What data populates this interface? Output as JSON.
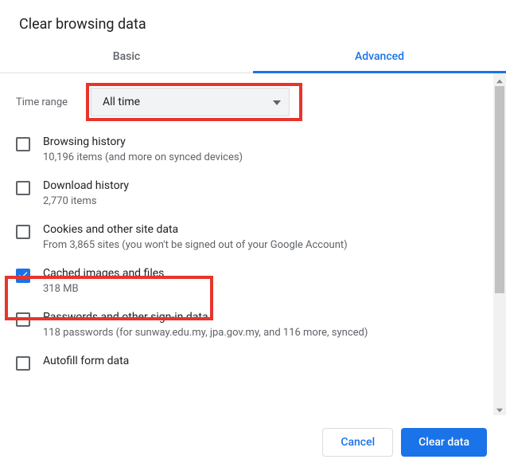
{
  "dialog": {
    "title": "Clear browsing data"
  },
  "tabs": {
    "basic": "Basic",
    "advanced": "Advanced"
  },
  "time_range": {
    "label": "Time range",
    "selected": "All time"
  },
  "items": [
    {
      "title": "Browsing history",
      "sub": "10,196 items (and more on synced devices)",
      "checked": false
    },
    {
      "title": "Download history",
      "sub": "2,770 items",
      "checked": false
    },
    {
      "title": "Cookies and other site data",
      "sub": "From 3,865 sites (you won't be signed out of your Google Account)",
      "checked": false
    },
    {
      "title": "Cached images and files",
      "sub": "318 MB",
      "checked": true
    },
    {
      "title": "Passwords and other sign-in data",
      "sub": "118 passwords (for sunway.edu.my, jpa.gov.my, and 116 more, synced)",
      "checked": false
    },
    {
      "title": "Autofill form data",
      "sub": "",
      "checked": false
    }
  ],
  "footer": {
    "cancel": "Cancel",
    "clear": "Clear data"
  }
}
